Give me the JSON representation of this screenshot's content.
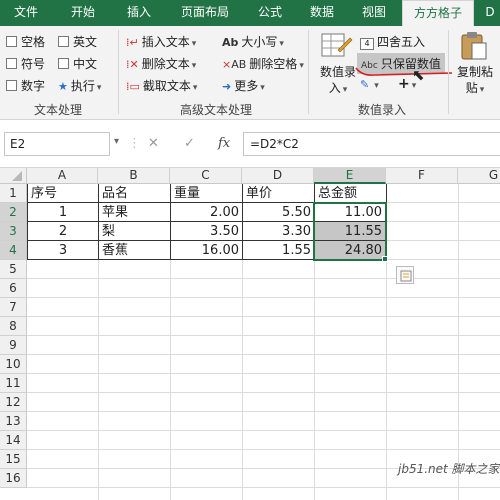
{
  "tabs": [
    "文件",
    "开始",
    "插入",
    "页面布局",
    "公式",
    "数据",
    "视图",
    "方方格子",
    "D"
  ],
  "ribbon": {
    "text_process": {
      "items": [
        "空格",
        "英文",
        "符号",
        "中文",
        "数字",
        "执行"
      ],
      "group_label": "文本处理"
    },
    "advanced_text": {
      "insert_text": "插入文本",
      "delete_text": "删除文本",
      "extract_text": "截取文本",
      "case": "大小写",
      "delete_space": "删除空格",
      "more": "更多",
      "group_label": "高级文本处理"
    },
    "value_entry": {
      "value_entry_btn": "数值录入",
      "round": "四舍五入",
      "keep_values": "只保留数值",
      "group_label": "数值录入"
    },
    "copy_paste": "复制粘贴",
    "icons": [
      "checkbox-icon",
      "insert-text-icon",
      "delete-text-icon",
      "extract-text-icon",
      "case-icon",
      "delete-space-icon",
      "more-icon",
      "value-entry-icon",
      "round-icon",
      "keep-values-icon",
      "plus-icon",
      "clipboard-icon"
    ]
  },
  "formula_bar": {
    "name_box": "E2",
    "fx": "fx",
    "formula": "=D2*C2"
  },
  "sheet": {
    "columns": [
      "A",
      "B",
      "C",
      "D",
      "E",
      "F",
      "G"
    ],
    "rows": [
      "1",
      "2",
      "3",
      "4",
      "5",
      "6",
      "7",
      "8",
      "9",
      "10",
      "11",
      "12",
      "13",
      "14",
      "15",
      "16"
    ],
    "header": [
      "序号",
      "品名",
      "重量",
      "单价",
      "总金额"
    ],
    "data": [
      [
        "1",
        "苹果",
        "2.00",
        "5.50",
        "11.00"
      ],
      [
        "2",
        "梨",
        "3.50",
        "3.30",
        "11.55"
      ],
      [
        "3",
        "香蕉",
        "16.00",
        "1.55",
        "24.80"
      ]
    ]
  },
  "watermark": "jb51.net 脚本之家",
  "colors": {
    "accent": "#217346",
    "selection": "#c6c6c6",
    "annotation": "#d22020"
  }
}
